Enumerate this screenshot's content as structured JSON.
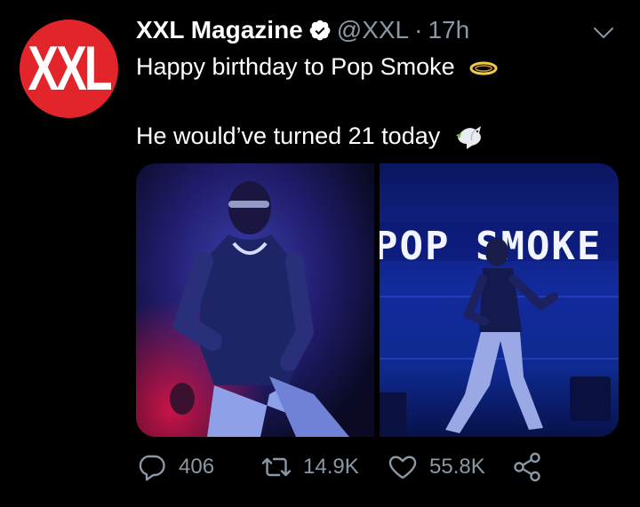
{
  "tweet": {
    "avatar_text": "XXL",
    "display_name": "XXL Magazine",
    "handle": "@XXL",
    "separator": "·",
    "time": "17h",
    "line1": "Happy birthday to Pop Smoke",
    "line2": "He would’ve turned 21 today",
    "banner_text": "POP SMOKE"
  },
  "stats": {
    "replies": "406",
    "retweets": "14.9K",
    "likes": "55.8K"
  },
  "icons": [
    "verified-badge-icon",
    "chevron-down-icon",
    "halo-emoji-icon",
    "dove-emoji-icon",
    "reply-icon",
    "retweet-icon",
    "like-icon",
    "share-icon"
  ],
  "colors": {
    "accent": "#e2252b",
    "muted": "#8b98a5",
    "background": "#000000"
  }
}
